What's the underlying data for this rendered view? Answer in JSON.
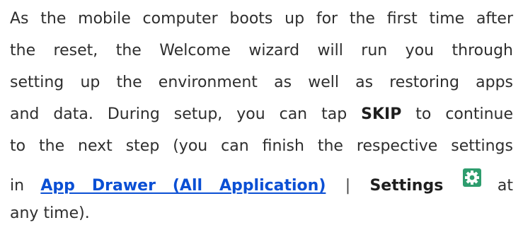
{
  "paragraph": {
    "line1": "As the mobile computer boots up for the first time after",
    "line2": "the reset, the Welcome wizard will run you through",
    "line3": "setting up the environment as well as restoring apps",
    "line4_pre": "and data. During setup, you can tap",
    "line4_bold": "SKIP",
    "line4_post": "to continue",
    "line5": "to the next step (you can finish the respective settings",
    "line6_pre": "in",
    "line6_link": "App Drawer (All Application)",
    "line6_sep": "|",
    "line6_bold": "Settings",
    "line6_post": "at",
    "line7": "any time)."
  },
  "icons": {
    "settings": "gear-icon"
  },
  "colors": {
    "text": "#2e2e2e",
    "link": "#0a4fd4",
    "icon_bg": "#2e9d6e"
  }
}
